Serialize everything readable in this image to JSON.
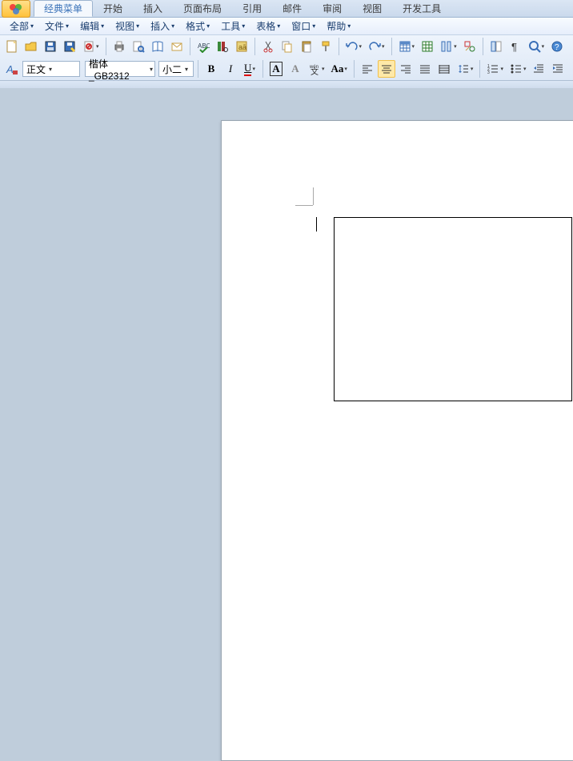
{
  "tabs": {
    "t0": "经典菜单",
    "t1": "开始",
    "t2": "插入",
    "t3": "页面布局",
    "t4": "引用",
    "t5": "邮件",
    "t6": "审阅",
    "t7": "视图",
    "t8": "开发工具"
  },
  "menus": {
    "m0": "全部",
    "m1": "文件",
    "m2": "编辑",
    "m3": "视图",
    "m4": "插入",
    "m5": "格式",
    "m6": "工具",
    "m7": "表格",
    "m8": "窗口",
    "m9": "帮助"
  },
  "style_combo": "正文",
  "font_combo": "楷体_GB2312",
  "size_combo": "小二",
  "glyphs": {
    "bold": "B",
    "italic": "I",
    "underline": "U",
    "boxA": "A",
    "shadeA": "A",
    "caseAa": "Aa"
  }
}
